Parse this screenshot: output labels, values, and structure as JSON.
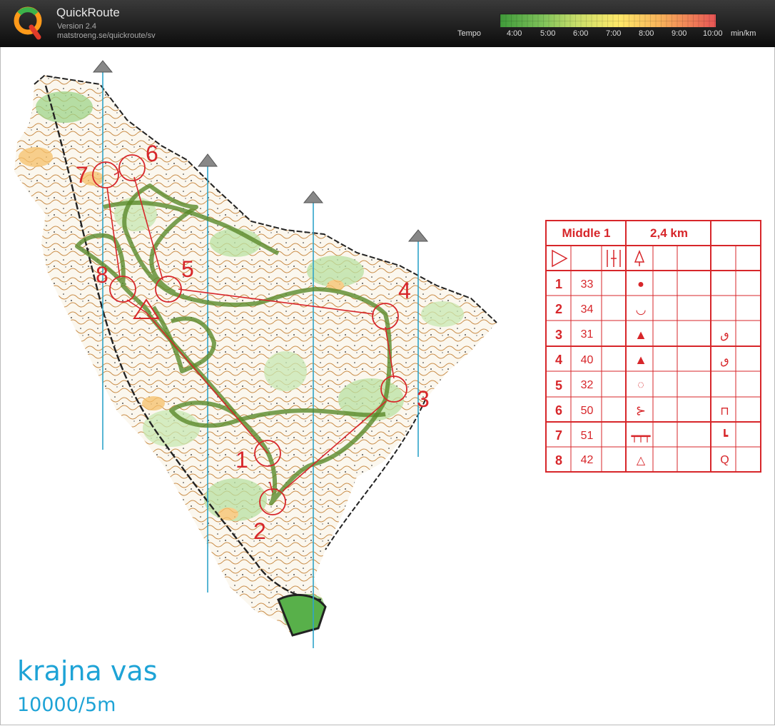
{
  "app": {
    "title": "QuickRoute",
    "version": "Version 2.4",
    "url": "matstroeng.se/quickroute/sv"
  },
  "tempo": {
    "label": "Tempo",
    "ticks": [
      "4:00",
      "5:00",
      "6:00",
      "7:00",
      "8:00",
      "9:00",
      "10:00"
    ],
    "unit": "min/km"
  },
  "map": {
    "name": "krajna vas",
    "scale": "10000/5m"
  },
  "controls_on_map": [
    "1",
    "2",
    "3",
    "4",
    "5",
    "6",
    "7",
    "8"
  ],
  "description": {
    "event": "Middle 1",
    "length": "2,4 km",
    "controls": [
      {
        "num": "1",
        "code": "33",
        "feature": "dot",
        "detail": ""
      },
      {
        "num": "2",
        "code": "34",
        "feature": "depression",
        "detail": ""
      },
      {
        "num": "3",
        "code": "31",
        "feature": "triangle",
        "detail": "top"
      },
      {
        "num": "4",
        "code": "40",
        "feature": "triangle",
        "detail": "top"
      },
      {
        "num": "5",
        "code": "32",
        "feature": "dotted-circle",
        "detail": ""
      },
      {
        "num": "6",
        "code": "50",
        "feature": "path-junction",
        "detail": "foot"
      },
      {
        "num": "7",
        "code": "51",
        "feature": "ruined-wall",
        "detail": "corner"
      },
      {
        "num": "8",
        "code": "42",
        "feature": "tree",
        "detail": "side"
      }
    ]
  },
  "colors": {
    "course": "#d7262a",
    "route": "#5a8a2a",
    "north_lines": "#2fa4c9",
    "title": "#1ea3d6"
  }
}
